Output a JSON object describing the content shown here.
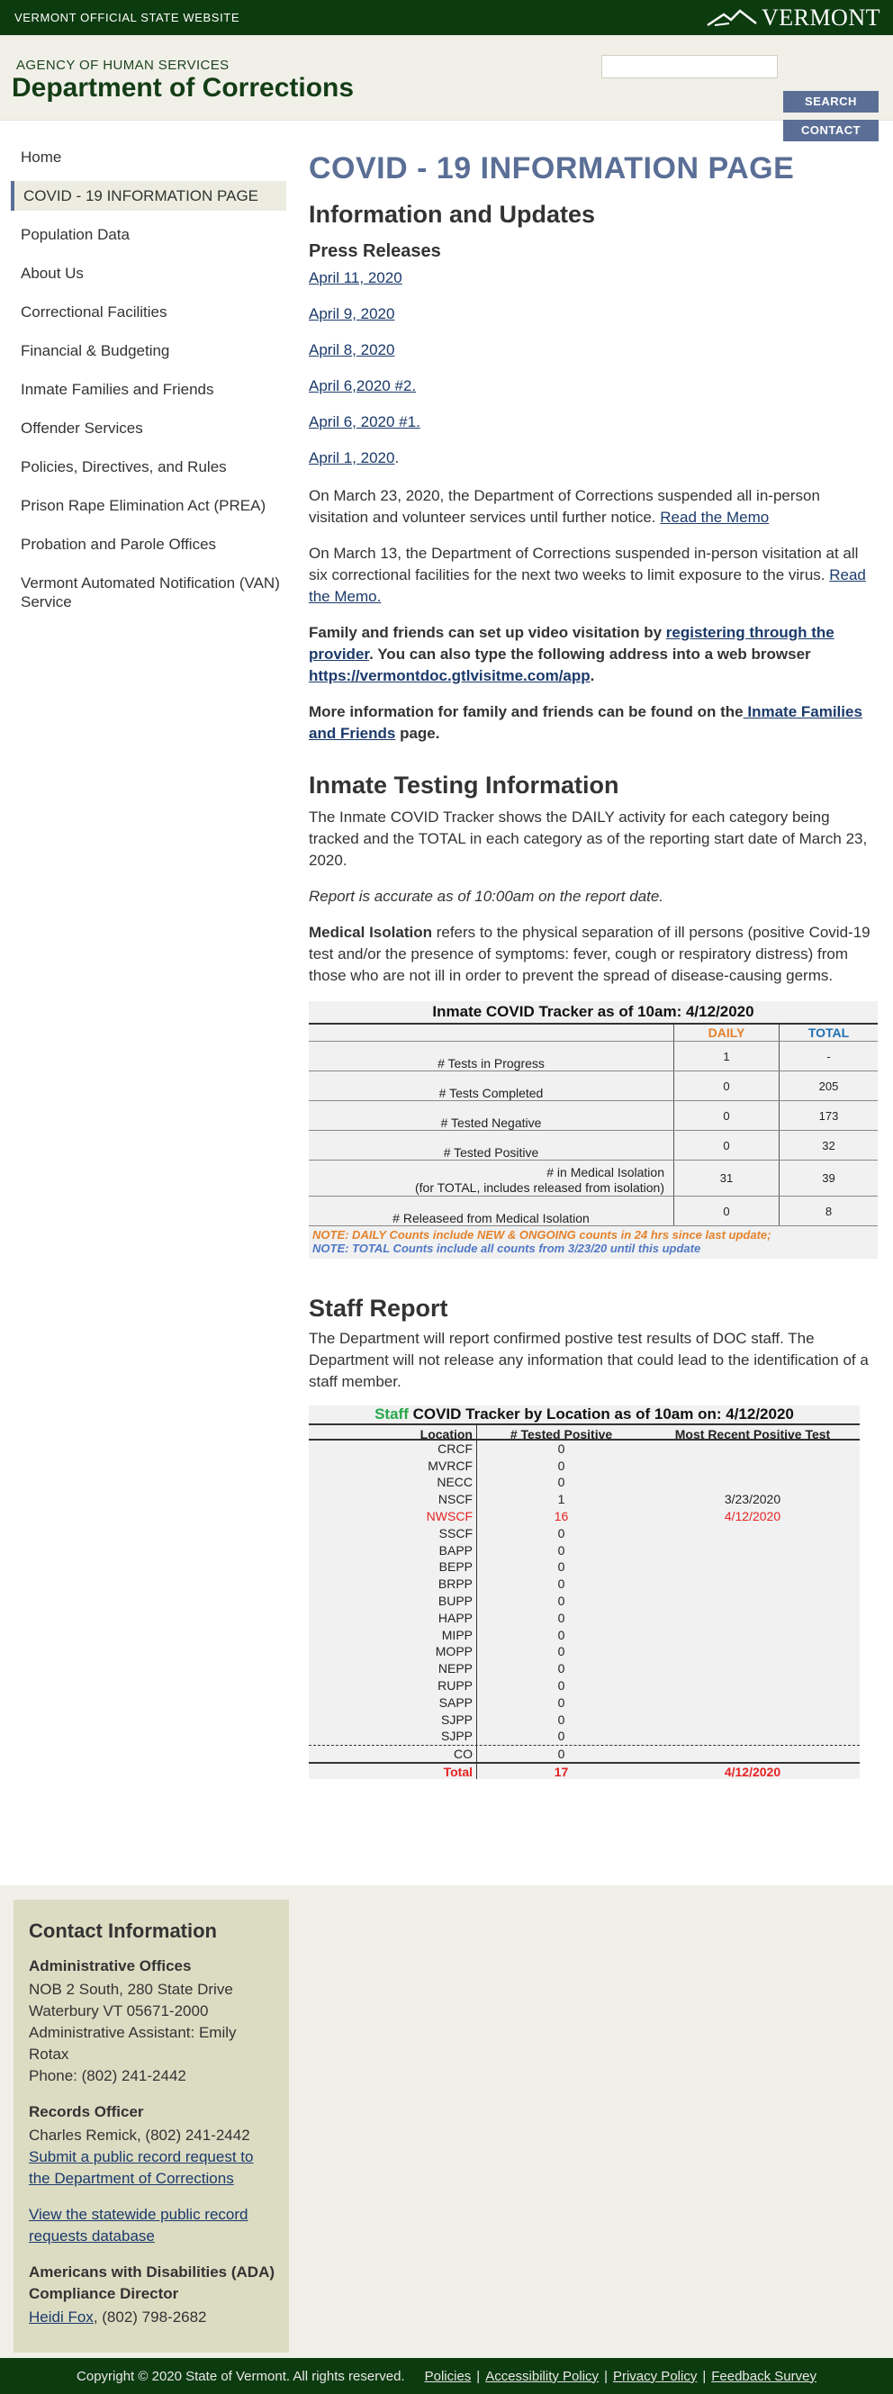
{
  "topbar": {
    "state_label": "VERMONT OFFICIAL STATE WEBSITE",
    "logo_text": "VERMONT",
    "logo_icon": "mountain-icon"
  },
  "header": {
    "agency": "AGENCY OF HUMAN SERVICES",
    "dept": "Department of Corrections",
    "search_placeholder": "",
    "search_button": "SEARCH",
    "contact_button": "CONTACT"
  },
  "sidebar": {
    "items": [
      {
        "label": "Home"
      },
      {
        "label": "COVID - 19 INFORMATION PAGE"
      },
      {
        "label": "Population Data"
      },
      {
        "label": "About Us"
      },
      {
        "label": "Correctional Facilities"
      },
      {
        "label": "Financial & Budgeting"
      },
      {
        "label": "Inmate Families and Friends"
      },
      {
        "label": "Offender Services"
      },
      {
        "label": "Policies, Directives, and Rules"
      },
      {
        "label": "Prison Rape Elimination Act (PREA)"
      },
      {
        "label": "Probation and Parole Offices"
      },
      {
        "label": "Vermont Automated Notification (VAN) Service"
      }
    ]
  },
  "main": {
    "title": "COVID - 19 INFORMATION PAGE",
    "updates_heading": "Information and Updates",
    "press_heading": "Press Releases",
    "press_links": [
      "April 11, 2020",
      "April 9, 2020",
      "April 8, 2020",
      "April 6,2020 #2.",
      "April 6, 2020 #1.",
      "April 1, 2020"
    ],
    "press_last_suffix": ".",
    "p1_text": "On March 23, 2020, the Department of Corrections suspended all in-person visitation and volunteer services until further notice. ",
    "p1_link": "Read the Memo",
    "p2_text": "On March 13, the Department of Corrections suspended in-person visitation at all six correctional facilities for the next two weeks to limit exposure to the virus.  ",
    "p2_link": "Read the Memo.",
    "p3_a": "Family and friends can set up video visitation by ",
    "p3_link1": "registering through the provider",
    "p3_b": ". You can also type the following address into a web browser ",
    "p3_link2": "https://vermontdoc.gtlvisitme.com/app",
    "p3_c": ".",
    "p4_a": "More information for family and friends can be found on the",
    "p4_link": " Inmate Families and Friends",
    "p4_b": " page.",
    "testing_heading": "Inmate Testing Information",
    "testing_p1": "The Inmate COVID Tracker shows the DAILY activity for each category being tracked and the TOTAL in each category as of the reporting start date of March 23, 2020.",
    "testing_p2": "Report is accurate as of 10:00am on the report date.",
    "testing_p3_bold": "Medical Isolation",
    "testing_p3_rest": " refers to the physical separation of ill persons (positive Covid-19 test and/or the presence of symptoms: fever, cough or respiratory distress) from those who are not ill in order to prevent the spread of disease-causing germs.",
    "staff_heading": "Staff Report",
    "staff_p": "The Department will report confirmed postive test results of DOC staff. The Department will not release any information that could lead to the identification of a staff member."
  },
  "inmate_tracker": {
    "title": "Inmate COVID Tracker as of 10am:  4/12/2020",
    "col_daily": "DAILY",
    "col_total": "TOTAL",
    "rows": [
      {
        "label": "# Tests in Progress",
        "sub": "",
        "daily": "1",
        "total": "-"
      },
      {
        "label": "# Tests Completed",
        "sub": "",
        "daily": "0",
        "total": "205"
      },
      {
        "label": "# Tested Negative",
        "sub": "",
        "daily": "0",
        "total": "173"
      },
      {
        "label": "# Tested Positive",
        "sub": "",
        "daily": "0",
        "total": "32"
      },
      {
        "label": "# in Medical Isolation",
        "sub": "(for TOTAL, includes released from isolation)",
        "daily": "31",
        "total": "39"
      },
      {
        "label": "# Releaseed from Medical Isolation",
        "sub": "",
        "daily": "0",
        "total": "8"
      }
    ],
    "note1": "NOTE: DAILY Counts include NEW & ONGOING counts in 24 hrs since last update;",
    "note2": "NOTE: TOTAL Counts include all counts from 3/23/20 until this update"
  },
  "staff_tracker": {
    "title_green": "Staff",
    "title_rest": " COVID Tracker by Location as of 10am on: 4/12/2020",
    "col_location": "Location",
    "col_positive": "# Tested Positive",
    "col_recent": "Most Recent Positive Test",
    "rows": [
      {
        "loc": "CRCF",
        "pos": "0",
        "last": ""
      },
      {
        "loc": "MVRCF",
        "pos": "0",
        "last": ""
      },
      {
        "loc": "NECC",
        "pos": "0",
        "last": ""
      },
      {
        "loc": "NSCF",
        "pos": "1",
        "last": "3/23/2020"
      },
      {
        "loc": "NWSCF",
        "pos": "16",
        "last": "4/12/2020"
      },
      {
        "loc": "SSCF",
        "pos": "0",
        "last": ""
      },
      {
        "loc": "BAPP",
        "pos": "0",
        "last": ""
      },
      {
        "loc": "BEPP",
        "pos": "0",
        "last": ""
      },
      {
        "loc": "BRPP",
        "pos": "0",
        "last": ""
      },
      {
        "loc": "BUPP",
        "pos": "0",
        "last": ""
      },
      {
        "loc": "HAPP",
        "pos": "0",
        "last": ""
      },
      {
        "loc": "MIPP",
        "pos": "0",
        "last": ""
      },
      {
        "loc": "MOPP",
        "pos": "0",
        "last": ""
      },
      {
        "loc": "NEPP",
        "pos": "0",
        "last": ""
      },
      {
        "loc": "RUPP",
        "pos": "0",
        "last": ""
      },
      {
        "loc": "SAPP",
        "pos": "0",
        "last": ""
      },
      {
        "loc": "SJPP",
        "pos": "0",
        "last": ""
      },
      {
        "loc": "SJPP",
        "pos": "0",
        "last": ""
      },
      {
        "loc": "CO",
        "pos": "0",
        "last": ""
      }
    ],
    "total_label": "Total",
    "total_pos": "17",
    "total_last": "4/12/2020"
  },
  "contact": {
    "title": "Contact Information",
    "admin_heading": "Administrative Offices",
    "admin_addr1": "NOB 2 South, 280 State Drive",
    "admin_addr2": "Waterbury VT 05671-2000",
    "admin_assistant": "Administrative Assistant: Emily Rotax",
    "admin_phone": "Phone: (802) 241-2442",
    "records_heading": "Records Officer",
    "records_name": "Charles Remick, (802) 241-2442",
    "records_link1": "Submit a public record request to the Department of Corrections",
    "records_link2": "View the statewide public record requests database",
    "ada_heading": "Americans with Disabilities (ADA) Compliance Director",
    "ada_link": "Heidi Fox",
    "ada_phone": ", (802) 798-2682"
  },
  "footer": {
    "copyright": "Copyright © 2020 State of Vermont. All rights reserved.",
    "links": [
      "Policies",
      "Accessibility Policy",
      "Privacy Policy",
      "Feedback Survey"
    ],
    "separator": "|"
  },
  "colors": {
    "dark_green": "#0d3b10",
    "accent_blue": "#5a6e96",
    "daily_orange": "#e4822c",
    "total_blue": "#1f6fb3",
    "alert_red": "#e62222",
    "staff_green": "#27a84a"
  }
}
